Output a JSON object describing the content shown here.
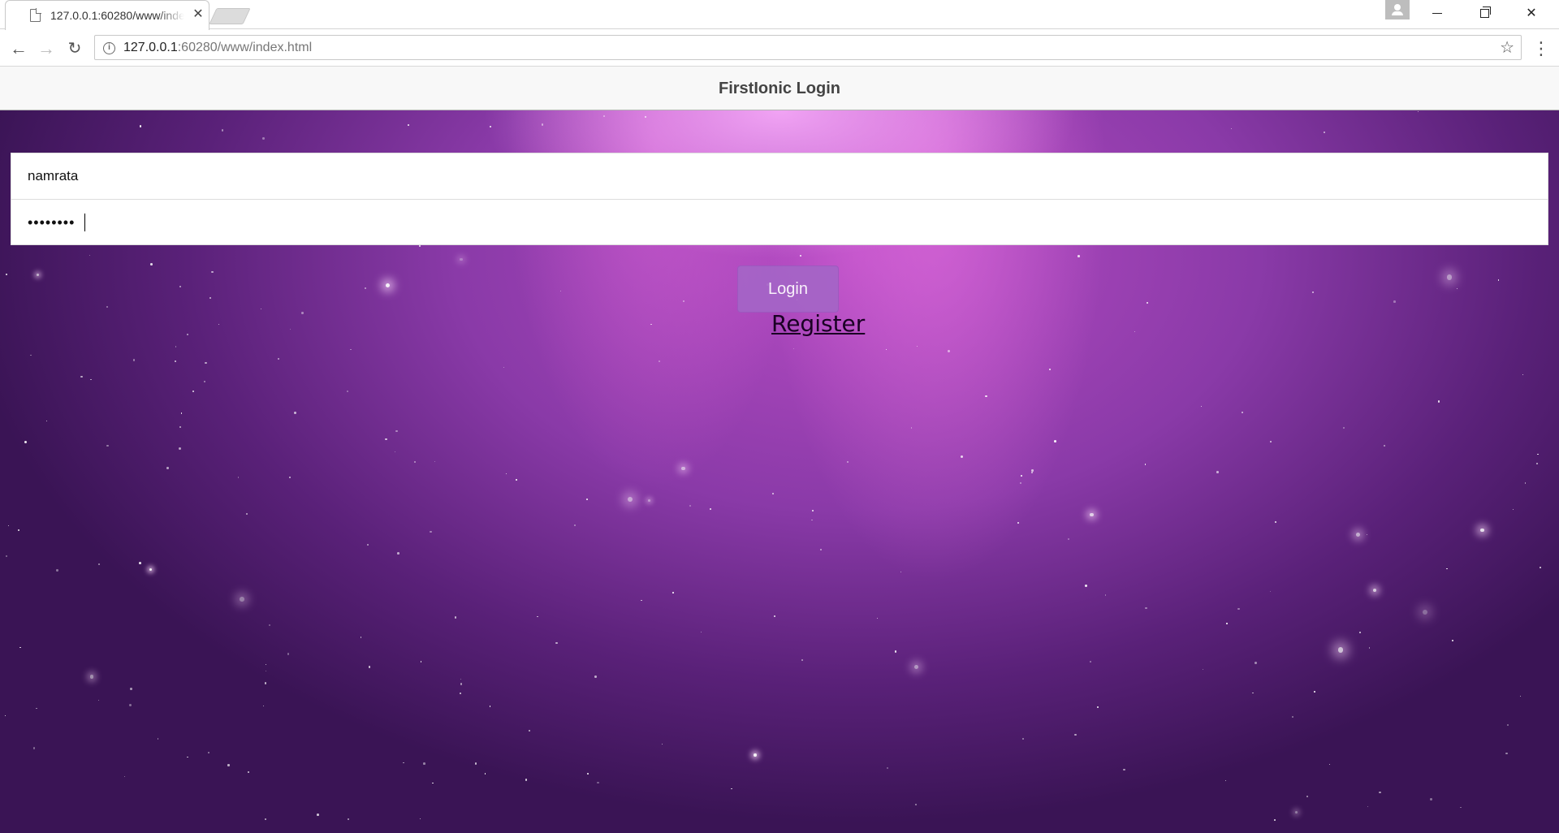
{
  "browser": {
    "tab_title": "127.0.0.1:60280/www/index.html",
    "url_host": "127.0.0.1",
    "url_rest": ":60280/www/index.html",
    "close_glyph": "✕",
    "back_glyph": "←",
    "forward_glyph": "→",
    "reload_glyph": "↻",
    "info_glyph": "i",
    "star_glyph": "☆",
    "menu_glyph": "⋮"
  },
  "app": {
    "title": "FirstIonic Login",
    "username_value": "namrata",
    "password_value": "••••••••",
    "login_label": "Login",
    "register_label": "Register"
  },
  "colors": {
    "header_bg": "#f8f8f8",
    "button_bg": "#a565c7",
    "background_accent": "#b74cc4"
  },
  "icons": [
    "page-icon",
    "close-icon",
    "profile-icon",
    "minimize-icon",
    "maximize-icon",
    "window-close-icon",
    "back-icon",
    "forward-icon",
    "reload-icon",
    "info-icon",
    "bookmark-star-icon",
    "menu-icon"
  ]
}
